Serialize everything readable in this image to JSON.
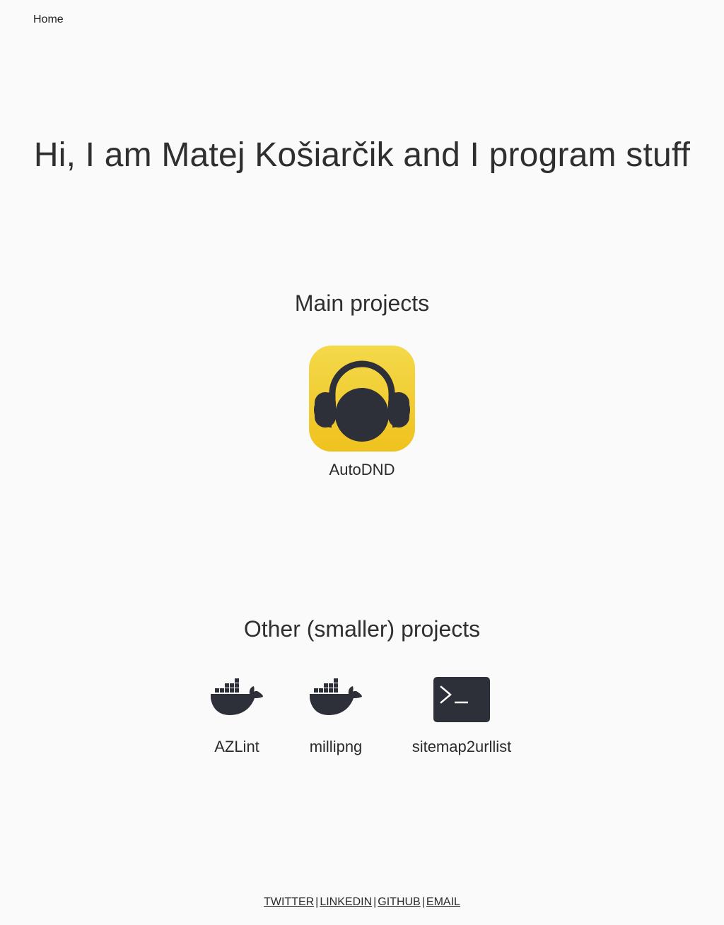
{
  "nav": {
    "home_label": "Home"
  },
  "hero": {
    "title": "Hi, I am Matej Košiarčik and I program stuff"
  },
  "main_projects": {
    "title": "Main projects",
    "items": [
      {
        "label": "AutoDND",
        "icon": "headphones-app-icon"
      }
    ]
  },
  "other_projects": {
    "title": "Other (smaller) projects",
    "items": [
      {
        "label": "AZLint",
        "icon": "docker-whale-icon"
      },
      {
        "label": "millipng",
        "icon": "docker-whale-icon"
      },
      {
        "label": "sitemap2urllist",
        "icon": "terminal-icon"
      }
    ]
  },
  "footer": {
    "links": [
      "TWITTER",
      "LINKEDIN",
      "GITHUB",
      "EMAIL"
    ],
    "separator": "|"
  },
  "colors": {
    "background": "#fafafa",
    "text": "#2b2b2b",
    "app_icon_yellow": "#f2cf2f",
    "icon_dark": "#2e3039"
  }
}
